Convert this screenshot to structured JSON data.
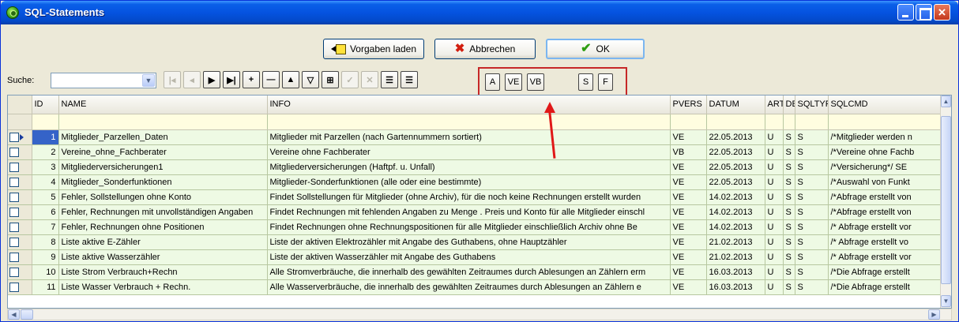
{
  "window": {
    "title": "SQL-Statements"
  },
  "dialog_buttons": {
    "load": "Vorgaben laden",
    "cancel": "Abbrechen",
    "ok": "OK"
  },
  "search": {
    "label": "Suche:",
    "value": ""
  },
  "navigator": {
    "buttons": [
      "first",
      "prior",
      "next",
      "last",
      "insert",
      "delete",
      "edit",
      "filter",
      "refresh",
      "post",
      "cancel",
      "add-lines",
      "remove-lines"
    ]
  },
  "scope_buttons": [
    "A",
    "VE",
    "VB",
    "S",
    "F"
  ],
  "colors": {
    "accent": "#0553e0",
    "highlight": "#c62828",
    "row_bg": "#eefae4",
    "filter_bg": "#fffde0"
  },
  "table": {
    "columns": [
      "ID",
      "NAME",
      "INFO",
      "PVERS",
      "DATUM",
      "ART",
      "DE",
      "SQLTYP",
      "SQLCMD"
    ],
    "rows": [
      [
        "1",
        "Mitglieder_Parzellen_Daten",
        "Mitglieder mit Parzellen (nach Gartennummern sortiert)",
        "VE",
        "22.05.2013",
        "U",
        "S",
        "S",
        "/*Mitglieder werden n"
      ],
      [
        "2",
        "Vereine_ohne_Fachberater",
        "Vereine ohne Fachberater",
        "VB",
        "22.05.2013",
        "U",
        "S",
        "S",
        "/*Vereine ohne Fachb"
      ],
      [
        "3",
        "Mitgliederversicherungen1",
        "Mitgliederversicherungen  (Haftpf. u. Unfall)",
        "VE",
        "22.05.2013",
        "U",
        "S",
        "S",
        "/*Versicherung*/  SE"
      ],
      [
        "4",
        "Mitglieder_Sonderfunktionen",
        "Mitglieder-Sonderfunktionen (alle oder eine bestimmte)",
        "VE",
        "22.05.2013",
        "U",
        "S",
        "S",
        "/*Auswahl von Funkt"
      ],
      [
        "5",
        "Fehler, Sollstellungen ohne Konto",
        "Findet Sollstellungen für Mitglieder (ohne Archiv), für die noch keine Rechnungen erstellt wurden",
        "VE",
        "14.02.2013",
        "U",
        "S",
        "S",
        "/*Abfrage erstellt von"
      ],
      [
        "6",
        "Fehler, Rechnungen mit unvollständigen Angaben",
        "Findet Rechnungen mit fehlenden Angaben zu Menge . Preis und Konto  für alle  Mitglieder einschl",
        "VE",
        "14.02.2013",
        "U",
        "S",
        "S",
        "/*Abfrage erstellt von"
      ],
      [
        "7",
        "Fehler, Rechnungen ohne Positionen",
        "Findet Rechnungen ohne Rechnungspositionen  für alle  Mitglieder einschließlich Archiv ohne Be",
        "VE",
        "14.02.2013",
        "U",
        "S",
        "S",
        "/* Abfrage erstellt vor"
      ],
      [
        "8",
        "Liste aktive E-Zähler",
        "Liste der aktiven Elektrozähler mit Angabe des Guthabens, ohne Hauptzähler",
        "VE",
        "21.02.2013",
        "U",
        "S",
        "S",
        "/*  Abfrage erstellt  vo"
      ],
      [
        "9",
        "Liste aktive Wasserzähler",
        "Liste der aktiven Wasserzähler mit Angabe des Guthabens",
        "VE",
        "21.02.2013",
        "U",
        "S",
        "S",
        "/* Abfrage erstellt vor"
      ],
      [
        "10",
        "Liste Strom Verbrauch+Rechn",
        "Alle Stromverbräuche, die innerhalb des gewählten Zeitraumes durch Ablesungen an Zählern erm",
        "VE",
        "16.03.2013",
        "U",
        "S",
        "S",
        "/*Die Abfrage erstellt"
      ],
      [
        "11",
        "Liste Wasser Verbrauch + Rechn.",
        "Alle Wasserverbräuche, die innerhalb des gewählten Zeitraumes durch Ablesungen an Zählern e",
        "VE",
        "16.03.2013",
        "U",
        "S",
        "S",
        "/*Die Abfrage erstellt"
      ]
    ]
  }
}
